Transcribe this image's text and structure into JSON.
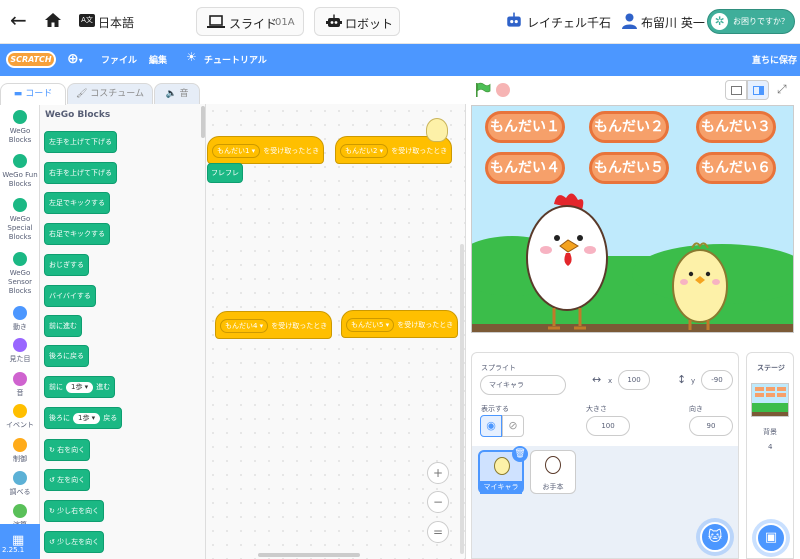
{
  "topbar": {
    "language": "日本語",
    "slide_label": "スライド",
    "slide_num": "01A",
    "robot_label": "ロボット",
    "teacher": "レイチェル千石",
    "student": "布留川 英一",
    "help": "お困りですか？"
  },
  "menubar": {
    "logo": "SCRATCH",
    "file": "ファイル",
    "edit": "編集",
    "tutorial": "チュートリアル",
    "save_now": "直ちに保存"
  },
  "tabs": {
    "code": "コード",
    "costume": "コスチューム",
    "sound": "音"
  },
  "categories": [
    {
      "label": "WeGo Blocks",
      "color": "#1bb884"
    },
    {
      "label": "WeGo Fun Blocks",
      "color": "#1bb884"
    },
    {
      "label": "WeGo Special Blocks",
      "color": "#1bb884"
    },
    {
      "label": "WeGo Sensor Blocks",
      "color": "#1bb884"
    },
    {
      "label": "動き",
      "color": "#4c97ff"
    },
    {
      "label": "見た目",
      "color": "#9966ff"
    },
    {
      "label": "音",
      "color": "#cf63cf"
    },
    {
      "label": "イベント",
      "color": "#ffbf00"
    },
    {
      "label": "制御",
      "color": "#ffab19"
    },
    {
      "label": "調べる",
      "color": "#5cb1d6"
    },
    {
      "label": "演算",
      "color": "#59c059"
    }
  ],
  "palette": {
    "title": "WeGo Blocks",
    "blocks": [
      {
        "pre": "左手を上げて下げる"
      },
      {
        "pre": "右手を上げて下げる"
      },
      {
        "pre": "左足でキックする"
      },
      {
        "pre": "右足でキックする"
      },
      {
        "pre": "おじぎする"
      },
      {
        "pre": "バイバイする"
      },
      {
        "pre": "前に進む"
      },
      {
        "pre": "後ろに戻る"
      },
      {
        "pre": "前に",
        "dd": "1歩 ▾",
        "post": "進む"
      },
      {
        "pre": "後ろに",
        "dd": "1歩 ▾",
        "post": "戻る"
      },
      {
        "pre": "↻ 右を向く"
      },
      {
        "pre": "↺ 左を向く"
      },
      {
        "pre": "↻ 少し右を向く"
      },
      {
        "pre": "↺ 少し左を向く"
      }
    ]
  },
  "code": {
    "hats": [
      {
        "dd": "もんだい1 ▾",
        "text": "を受け取ったとき"
      },
      {
        "dd": "もんだい2 ▾",
        "text": "を受け取ったとき"
      },
      {
        "dd": "もんだい4 ▾",
        "text": "を受け取ったとき"
      },
      {
        "dd": "もんだい5 ▾",
        "text": "を受け取ったとき"
      }
    ],
    "stack_block": "フレフレ"
  },
  "stage": {
    "buttons": [
      "もんだい１",
      "もんだい２",
      "もんだい３",
      "もんだい４",
      "もんだい５",
      "もんだい６"
    ],
    "button_color": "#f6a06a"
  },
  "sprite_info": {
    "label": "スプライト",
    "name": "マイキャラ",
    "x_label": "x",
    "x": "100",
    "y_label": "y",
    "y": "-90",
    "show_label": "表示する",
    "size_label": "大きさ",
    "size": "100",
    "direction_label": "向き",
    "direction": "90"
  },
  "sprites": [
    {
      "name": "マイキャラ"
    },
    {
      "name": "お手本"
    }
  ],
  "stage_panel": {
    "title": "ステージ",
    "backdrop_label": "背景",
    "backdrop_count": "4"
  },
  "version": "2.25.1"
}
